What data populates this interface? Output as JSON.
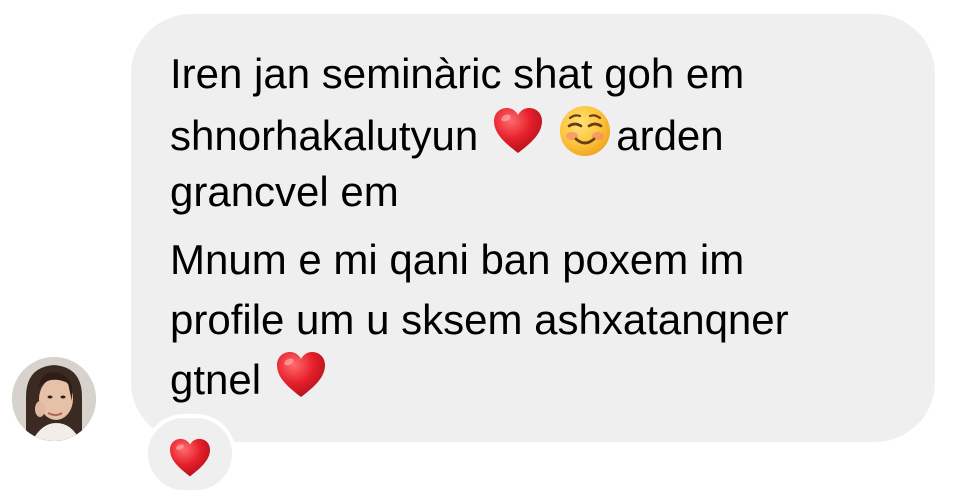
{
  "message": {
    "line1": "Iren jan seminàric shat goh em",
    "line2_text": "shnorhakalutyun",
    "line2_after": "arden",
    "line3": "grancvel em",
    "line4": "Mnum e mi qani ban poxem im",
    "line5": "profile um u sksem ashxatanqner",
    "line6_text": "gtnel"
  },
  "emojis": {
    "heart": "heart-emoji",
    "smile": "smiling-face-emoji"
  },
  "reaction": {
    "icon": "heart-emoji"
  },
  "colors": {
    "bubble": "#efefef",
    "heart": "#e5202b",
    "text": "#000000"
  }
}
